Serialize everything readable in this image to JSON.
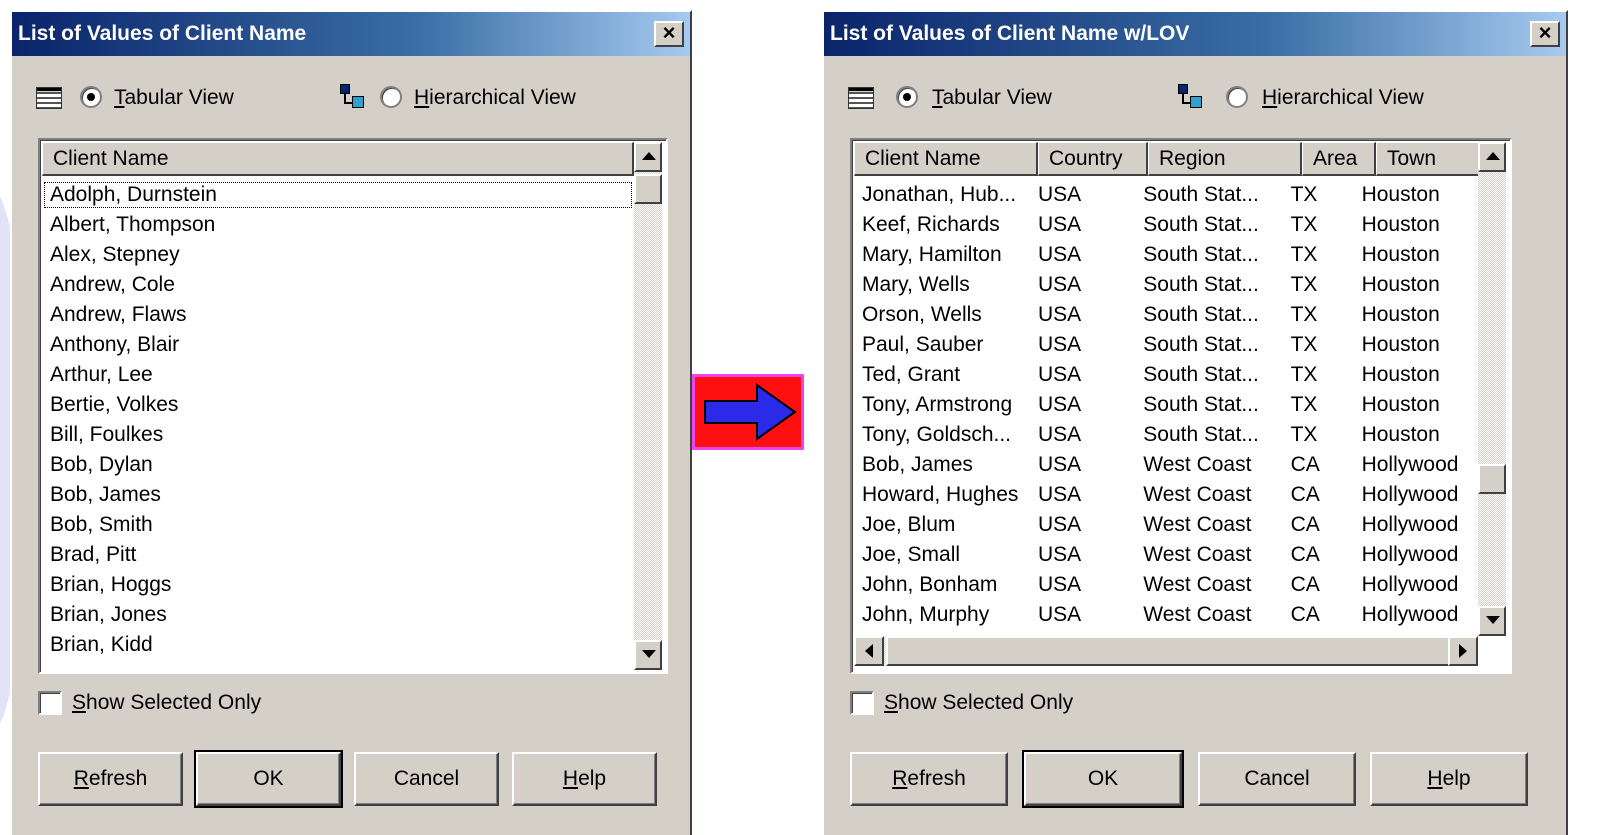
{
  "colors": {
    "title_gradient_start": "#0a246a",
    "title_gradient_end": "#a6caf0",
    "dialog_face": "#d4d0c8",
    "arrow_fill": "#2a2ae8",
    "arrow_box": "#ff1010",
    "arrow_box_border": "#ee44ee"
  },
  "left_dialog": {
    "title": "List of Values of Client Name",
    "close_glyph": "×",
    "tabular_view_label": "Tabular View",
    "tabular_view_selected": true,
    "hierarchical_view_label": "Hierarchical View",
    "columns": [
      "Client Name"
    ],
    "rows": [
      [
        "Adolph, Durnstein"
      ],
      [
        "Albert, Thompson"
      ],
      [
        "Alex, Stepney"
      ],
      [
        "Andrew, Cole"
      ],
      [
        "Andrew, Flaws"
      ],
      [
        "Anthony, Blair"
      ],
      [
        "Arthur, Lee"
      ],
      [
        "Bertie, Volkes"
      ],
      [
        "Bill, Foulkes"
      ],
      [
        "Bob, Dylan"
      ],
      [
        "Bob, James"
      ],
      [
        "Bob, Smith"
      ],
      [
        "Brad, Pitt"
      ],
      [
        "Brian, Hoggs"
      ],
      [
        "Brian, Jones"
      ],
      [
        "Brian, Kidd"
      ]
    ],
    "focused_row": 0,
    "show_selected_only_label": "Show Selected Only",
    "show_selected_only_checked": false,
    "buttons": {
      "refresh": "Refresh",
      "ok": "OK",
      "cancel": "Cancel",
      "help": "Help"
    }
  },
  "right_dialog": {
    "title": "List of Values of Client Name w/LOV",
    "close_glyph": "×",
    "tabular_view_label": "Tabular View",
    "tabular_view_selected": true,
    "hierarchical_view_label": "Hierarchical View",
    "columns": [
      "Client Name",
      "Country",
      "Region",
      "Area",
      "Town"
    ],
    "rows": [
      [
        "Jonathan, Hub...",
        "USA",
        "South Stat...",
        "TX",
        "Houston"
      ],
      [
        "Keef, Richards",
        "USA",
        "South Stat...",
        "TX",
        "Houston"
      ],
      [
        "Mary, Hamilton",
        "USA",
        "South Stat...",
        "TX",
        "Houston"
      ],
      [
        "Mary, Wells",
        "USA",
        "South Stat...",
        "TX",
        "Houston"
      ],
      [
        "Orson, Wells",
        "USA",
        "South Stat...",
        "TX",
        "Houston"
      ],
      [
        "Paul, Sauber",
        "USA",
        "South Stat...",
        "TX",
        "Houston"
      ],
      [
        "Ted, Grant",
        "USA",
        "South Stat...",
        "TX",
        "Houston"
      ],
      [
        "Tony, Armstrong",
        "USA",
        "South Stat...",
        "TX",
        "Houston"
      ],
      [
        "Tony, Goldsch...",
        "USA",
        "South Stat...",
        "TX",
        "Houston"
      ],
      [
        "Bob, James",
        "USA",
        "West Coast",
        "CA",
        "Hollywood"
      ],
      [
        "Howard, Hughes",
        "USA",
        "West Coast",
        "CA",
        "Hollywood"
      ],
      [
        "Joe, Blum",
        "USA",
        "West Coast",
        "CA",
        "Hollywood"
      ],
      [
        "Joe, Small",
        "USA",
        "West Coast",
        "CA",
        "Hollywood"
      ],
      [
        "John, Bonham",
        "USA",
        "West Coast",
        "CA",
        "Hollywood"
      ],
      [
        "John, Murphy",
        "USA",
        "West Coast",
        "CA",
        "Hollywood"
      ]
    ],
    "show_selected_only_label": "Show Selected Only",
    "show_selected_only_checked": false,
    "buttons": {
      "refresh": "Refresh",
      "ok": "OK",
      "cancel": "Cancel",
      "help": "Help"
    }
  },
  "icons": {
    "tabular_view": "grid-icon",
    "hierarchical_view": "hierarchy-icon",
    "transition": "right-arrow-icon"
  }
}
